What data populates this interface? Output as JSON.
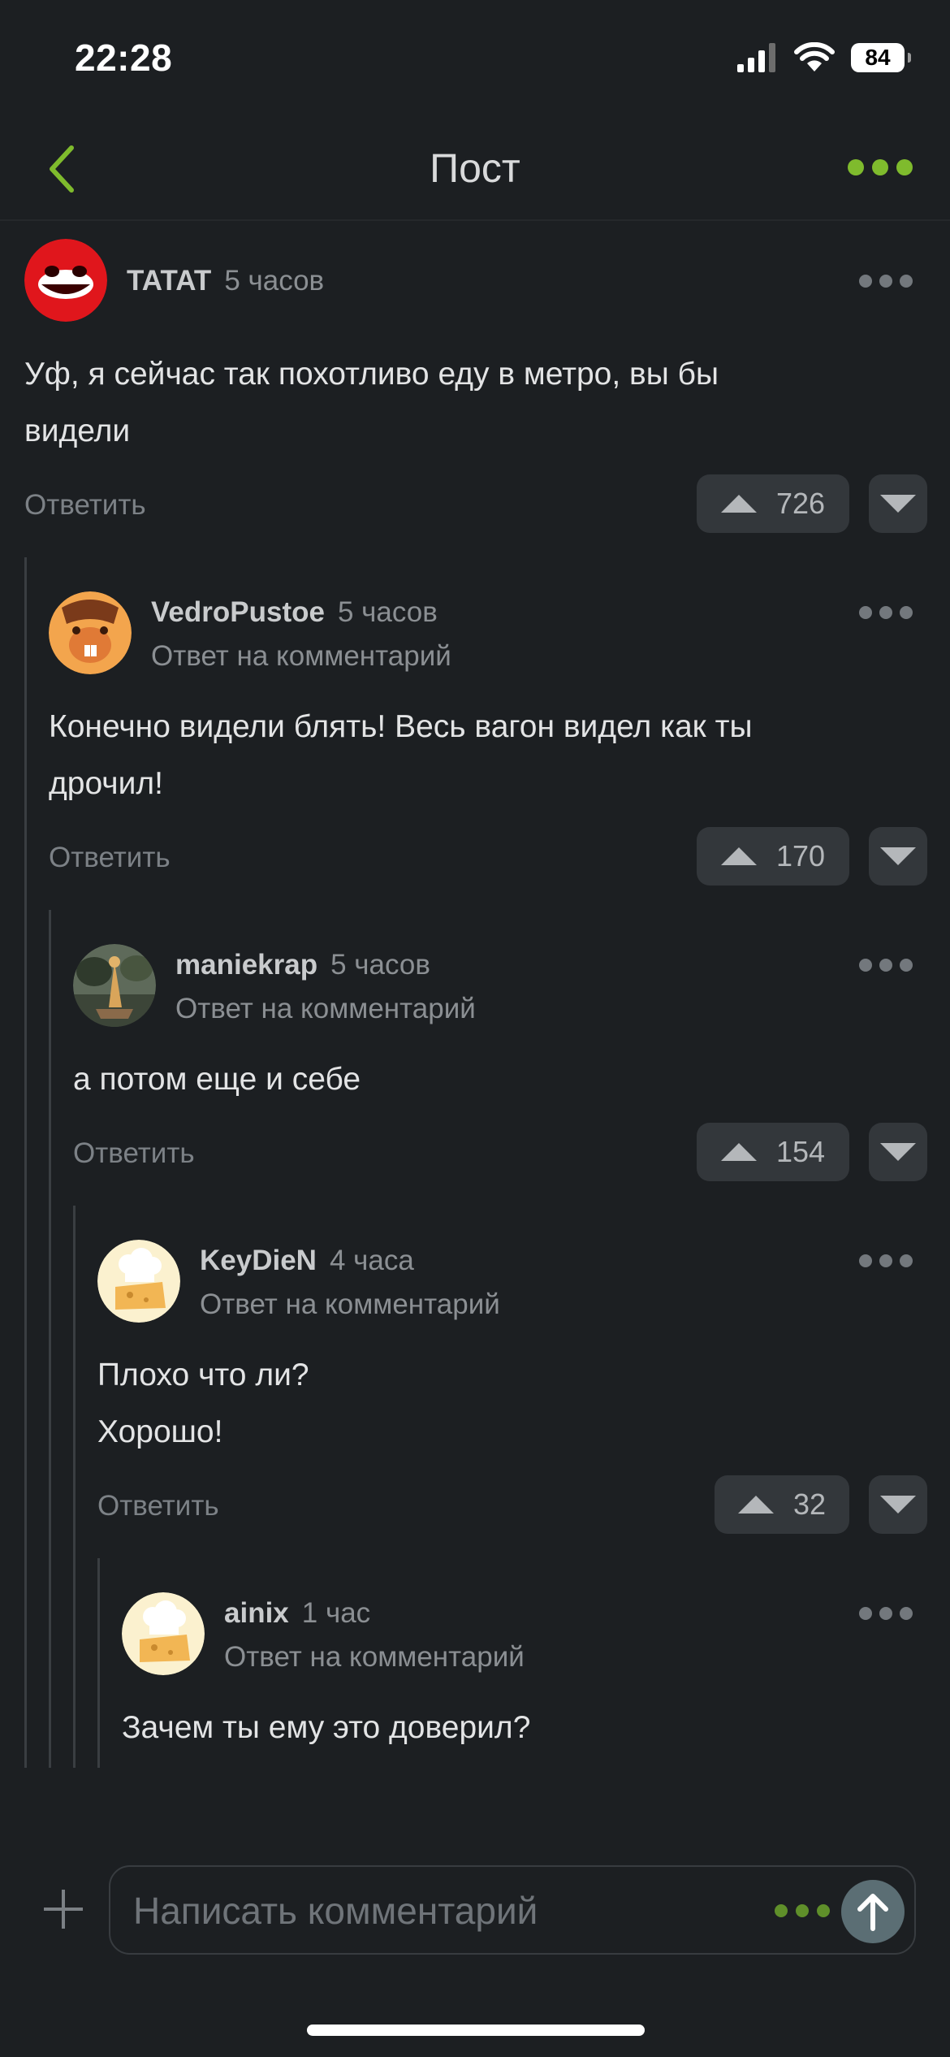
{
  "status_bar": {
    "time": "22:28",
    "battery": "84"
  },
  "header": {
    "title": "Пост"
  },
  "comments": [
    {
      "author": "TATAT",
      "ago": "5 часов",
      "text": [
        "Уф, я сейчас так похотливо еду в метро, вы бы",
        "видели"
      ],
      "reply_label": "Ответить",
      "votes": "726"
    },
    {
      "author": "VedroPustoe",
      "ago": "5 часов",
      "reply_to": "Ответ на комментарий",
      "text": [
        "Конечно видели блять! Весь вагон видел как ты",
        "дрочил!"
      ],
      "reply_label": "Ответить",
      "votes": "170"
    },
    {
      "author": "maniekrap",
      "ago": "5 часов",
      "reply_to": "Ответ на комментарий",
      "text": [
        "а потом еще и себе"
      ],
      "reply_label": "Ответить",
      "votes": "154"
    },
    {
      "author": "KeyDieN",
      "ago": "4 часа",
      "reply_to": "Ответ на комментарий",
      "text": [
        "Плохо что ли?",
        "Хорошо!"
      ],
      "reply_label": "Ответить",
      "votes": "32"
    },
    {
      "author": "ainix",
      "ago": "1 час",
      "reply_to": "Ответ на комментарий",
      "text": [
        "Зачем ты ему это доверил?"
      ]
    }
  ],
  "composer": {
    "placeholder": "Написать комментарий"
  },
  "colors": {
    "background": "#1c1f22",
    "accent": "#7fbb2d",
    "button_bg": "#33373b"
  }
}
